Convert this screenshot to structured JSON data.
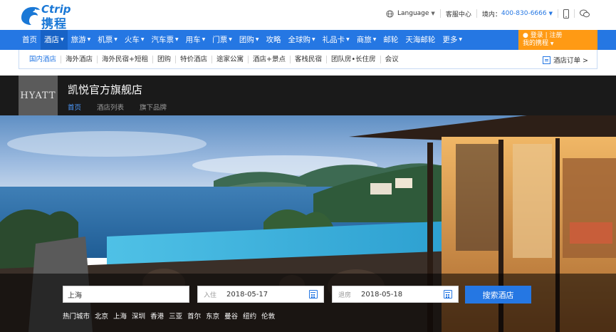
{
  "header": {
    "logo_en": "Ctrip",
    "logo_cn": "携程",
    "language": "Language",
    "service": "客服中心",
    "phone_prefix": "境内：",
    "phone": "400-830-6666"
  },
  "main_nav": [
    {
      "label": "首页",
      "dropdown": false
    },
    {
      "label": "酒店",
      "dropdown": true,
      "active": true
    },
    {
      "label": "旅游",
      "dropdown": true
    },
    {
      "label": "机票",
      "dropdown": true
    },
    {
      "label": "火车",
      "dropdown": true
    },
    {
      "label": "汽车票",
      "dropdown": true
    },
    {
      "label": "用车",
      "dropdown": true
    },
    {
      "label": "门票",
      "dropdown": true
    },
    {
      "label": "团购",
      "dropdown": true
    },
    {
      "label": "攻略",
      "dropdown": false
    },
    {
      "label": "全球购",
      "dropdown": true
    },
    {
      "label": "礼品卡",
      "dropdown": true
    },
    {
      "label": "商旅",
      "dropdown": true
    },
    {
      "label": "邮轮",
      "dropdown": false
    },
    {
      "label": "天海邮轮",
      "dropdown": false
    },
    {
      "label": "更多",
      "dropdown": true
    }
  ],
  "account": {
    "login": "登录",
    "register": "注册",
    "my_ctrip": "我的携程"
  },
  "sub_nav": [
    "国内酒店",
    "海外酒店",
    "海外民宿+短租",
    "团购",
    "特价酒店",
    "途家公寓",
    "酒店+景点",
    "客栈民宿",
    "团队房•长住房",
    "会议"
  ],
  "hotel_orders": "酒店订单 >",
  "brand": {
    "logo_text": "HYATT",
    "title": "凯悦官方旗舰店",
    "tabs": [
      "首页",
      "酒店列表",
      "旗下品牌"
    ]
  },
  "search": {
    "city_value": "上海",
    "checkin_label": "入住",
    "checkin_value": "2018-05-17",
    "checkout_label": "退房",
    "checkout_value": "2018-05-18",
    "button": "搜索酒店",
    "hot_cities": [
      "热门城市",
      "北京",
      "上海",
      "深圳",
      "香港",
      "三亚",
      "首尔",
      "东京",
      "曼谷",
      "纽约",
      "伦敦"
    ]
  },
  "colors": {
    "brand_blue": "#2577e3",
    "login_orange": "#ff9a14",
    "brand_bar": "#1a1a1a"
  }
}
